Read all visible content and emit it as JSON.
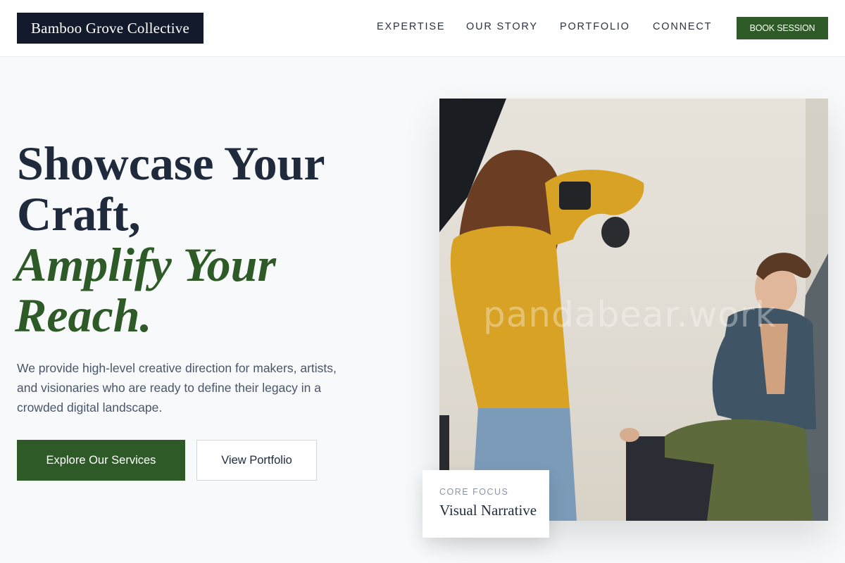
{
  "header": {
    "logo": "Bamboo Grove Collective",
    "nav": [
      "EXPERTISE",
      "OUR STORY",
      "PORTFOLIO",
      "CONNECT"
    ],
    "cta": "BOOK SESSION"
  },
  "hero": {
    "headline_line1": "Showcase Your",
    "headline_line2": "Craft,",
    "headline_accent_line1": "Amplify Your",
    "headline_accent_line2": "Reach.",
    "intro": "We provide high-level creative direction for makers, artists, and visionaries who are ready to define their legacy in a crowded digital landscape.",
    "primary_button": "Explore Our Services",
    "secondary_button": "View Portfolio"
  },
  "image": {
    "watermark": "pandabear.work"
  },
  "focus_card": {
    "kicker": "CORE FOCUS",
    "title": "Visual Narrative"
  },
  "colors": {
    "brand_green": "#2e5a27",
    "navy": "#121a2c",
    "text": "#1f2a3c",
    "muted": "#4a5568",
    "background": "#f8f9fa"
  }
}
